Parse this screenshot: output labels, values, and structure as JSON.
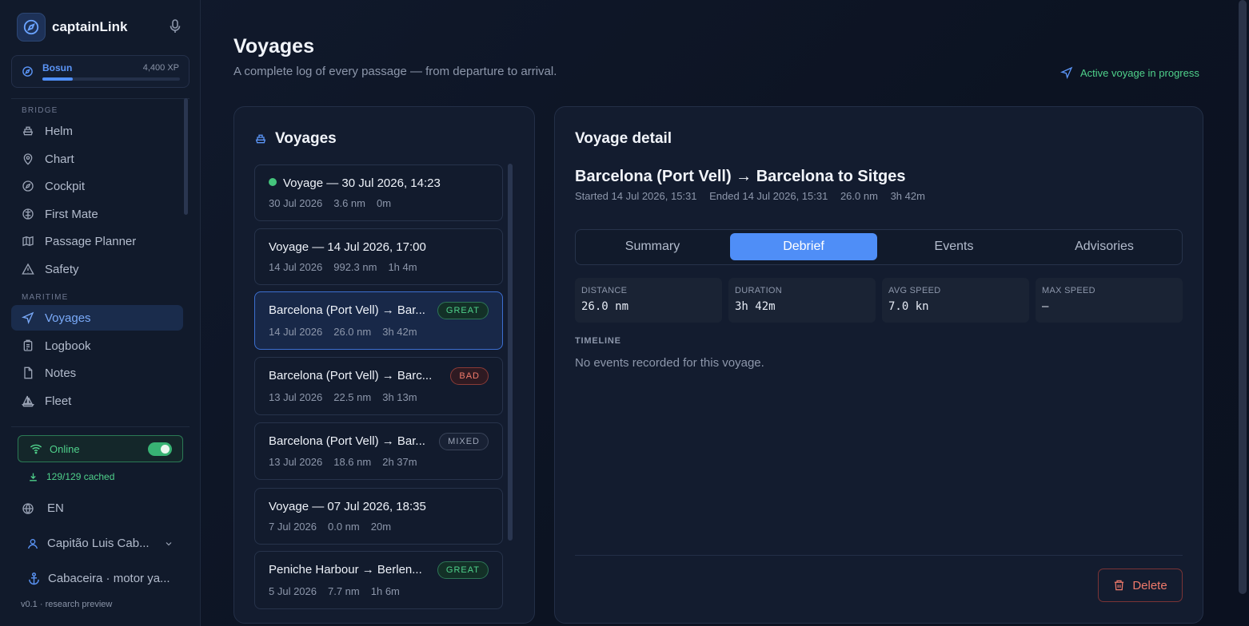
{
  "app": {
    "name": "captainLink",
    "version": "v0.1 · research preview"
  },
  "rank": {
    "name": "Bosun",
    "xp": "4,400 XP",
    "progress": 0.22
  },
  "sidebar": {
    "sections": [
      {
        "label": "BRIDGE",
        "items": [
          {
            "label": "Helm",
            "icon": "ship-wheel-icon"
          },
          {
            "label": "Chart",
            "icon": "map-pin-icon"
          },
          {
            "label": "Cockpit",
            "icon": "compass-icon"
          },
          {
            "label": "First Mate",
            "icon": "brain-icon"
          },
          {
            "label": "Passage Planner",
            "icon": "map-icon"
          },
          {
            "label": "Safety",
            "icon": "warning-icon"
          }
        ]
      },
      {
        "label": "MARITIME",
        "items": [
          {
            "label": "Voyages",
            "icon": "navigation-icon",
            "active": true
          },
          {
            "label": "Logbook",
            "icon": "clipboard-icon"
          },
          {
            "label": "Notes",
            "icon": "file-icon"
          },
          {
            "label": "Fleet",
            "icon": "sailboat-icon"
          }
        ]
      }
    ],
    "online": {
      "label": "Online",
      "enabled": true
    },
    "cached": "129/129 cached",
    "language": "EN",
    "user": "Capitão Luis Cab...",
    "vessel": "Cabaceira · motor ya..."
  },
  "page": {
    "title": "Voyages",
    "subtitle": "A complete log of every passage — from departure to arrival.",
    "active_status": "Active voyage in progress"
  },
  "voyage_list": {
    "title": "Voyages",
    "items": [
      {
        "title": "Voyage — 30 Jul 2026, 14:23",
        "date": "30 Jul 2026",
        "distance": "3.6 nm",
        "duration": "0m",
        "live": true,
        "badge": ""
      },
      {
        "title": "Voyage — 14 Jul 2026, 17:00",
        "date": "14 Jul 2026",
        "distance": "992.3 nm",
        "duration": "1h 4m",
        "badge": ""
      },
      {
        "title": "Barcelona (Port Vell) → Bar...",
        "date": "14 Jul 2026",
        "distance": "26.0 nm",
        "duration": "3h 42m",
        "badge": "GREAT",
        "selected": true
      },
      {
        "title": "Barcelona (Port Vell) → Barc...",
        "date": "13 Jul 2026",
        "distance": "22.5 nm",
        "duration": "3h 13m",
        "badge": "BAD"
      },
      {
        "title": "Barcelona (Port Vell) → Bar...",
        "date": "13 Jul 2026",
        "distance": "18.6 nm",
        "duration": "2h 37m",
        "badge": "MIXED"
      },
      {
        "title": "Voyage — 07 Jul 2026, 18:35",
        "date": "7 Jul 2026",
        "distance": "0.0 nm",
        "duration": "20m",
        "badge": ""
      },
      {
        "title": "Peniche Harbour → Berlen...",
        "date": "5 Jul 2026",
        "distance": "7.7 nm",
        "duration": "1h 6m",
        "badge": "GREAT"
      }
    ]
  },
  "detail": {
    "header": "Voyage detail",
    "route": "Barcelona (Port Vell) → Barcelona to Sitges",
    "started": "Started 14 Jul 2026, 15:31",
    "ended": "Ended 14 Jul 2026, 15:31",
    "distance": "26.0 nm",
    "duration": "3h 42m",
    "tabs": [
      "Summary",
      "Debrief",
      "Events",
      "Advisories"
    ],
    "active_tab": "Debrief",
    "stats": [
      {
        "label": "DISTANCE",
        "value": "26.0 nm"
      },
      {
        "label": "DURATION",
        "value": "3h 42m"
      },
      {
        "label": "AVG SPEED",
        "value": "7.0 kn"
      },
      {
        "label": "MAX SPEED",
        "value": "—"
      }
    ],
    "timeline_label": "TIMELINE",
    "timeline_empty": "No events recorded for this voyage.",
    "delete_label": "Delete"
  },
  "colors": {
    "accent": "#4f8ef7",
    "success": "#4fd18b",
    "danger": "#f07a6b",
    "background": "#0d1424"
  }
}
